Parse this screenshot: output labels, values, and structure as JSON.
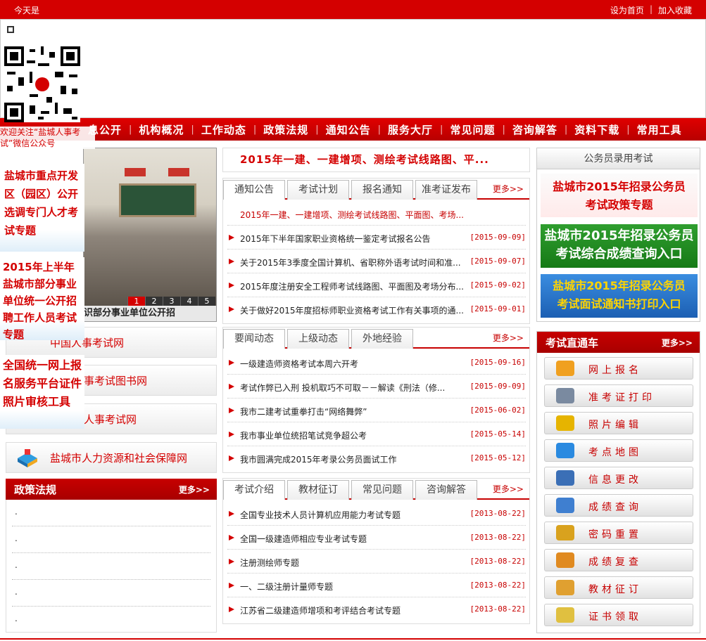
{
  "topbar": {
    "today": "今天是",
    "set_home": "设为首页",
    "sep": "|",
    "add_fav": "加入收藏"
  },
  "nav": {
    "items": [
      "息公开",
      "机构概况",
      "工作动态",
      "政策法规",
      "通知公告",
      "服务大厅",
      "常见问题",
      "咨询解答",
      "资料下载",
      "常用工具"
    ]
  },
  "qr": {
    "caption": "欢迎关注“盐城人事考试”微信公众号"
  },
  "slider": {
    "caption": "识部分事业单位公开招",
    "pages": [
      "1",
      "2",
      "3",
      "4",
      "5"
    ],
    "active": "1"
  },
  "floating_ads": {
    "ad1": "盐城市重点开发区（园区）公开选调专门人才考试专题",
    "ad2": "2015年上半年盐城市部分事业单位统一公开招聘工作人员考试专题",
    "ad3": "全国统一网上报名服务平台证件照片审核工具"
  },
  "left_links": [
    "中国人事考试网",
    "事考试图书网",
    "人事考试网",
    "盐城市人力资源和社会保障网"
  ],
  "policy": {
    "title": "政策法规",
    "more": "更多>>",
    "items": [
      ".",
      ".",
      ".",
      ".",
      "."
    ]
  },
  "headline": "2015年一建、一建增项、测绘考试线路图、平...",
  "panel1": {
    "tabs": [
      "通知公告",
      "考试计划",
      "报名通知",
      "准考证发布"
    ],
    "more": "更多>>",
    "featured": "2015年一建、一建增项、测绘考试线路图、平面图、考场...",
    "rows": [
      {
        "text": "2015年下半年国家职业资格统一鉴定考试报名公告",
        "date": "[2015-09-09]"
      },
      {
        "text": "关于2015年3季度全国计算机、省职称外语考试时间和准...",
        "date": "[2015-09-07]"
      },
      {
        "text": "2015年度注册安全工程师考试线路图、平面图及考场分布...",
        "date": "[2015-09-02]"
      },
      {
        "text": "关于做好2015年度招标师职业资格考试工作有关事项的通...",
        "date": "[2015-09-01]"
      }
    ]
  },
  "panel2": {
    "tabs": [
      "要闻动态",
      "上级动态",
      "外地经验"
    ],
    "more": "更多>>",
    "rows": [
      {
        "text": "一级建造师资格考试本周六开考",
        "date": "[2015-09-16]"
      },
      {
        "text": "考试作弊已入刑 投机取巧不可取－－解读《刑法（修...",
        "date": "[2015-09-09]"
      },
      {
        "text": "我市二建考试重拳打击“网络舞弊”",
        "date": "[2015-06-02]"
      },
      {
        "text": "我市事业单位统招笔试竞争超公考",
        "date": "[2015-05-14]"
      },
      {
        "text": "我市圆满完成2015年考录公务员面试工作",
        "date": "[2015-05-12]"
      }
    ]
  },
  "panel3": {
    "tabs": [
      "考试介绍",
      "教材征订",
      "常见问题",
      "咨询解答"
    ],
    "more": "更多>>",
    "rows": [
      {
        "text": "全国专业技术人员计算机应用能力考试专题",
        "date": "[2013-08-22]"
      },
      {
        "text": "全国一级建造师相应专业考试专题",
        "date": "[2013-08-22]"
      },
      {
        "text": "注册测绘师专题",
        "date": "[2013-08-22]"
      },
      {
        "text": "一、二级注册计量师专题",
        "date": "[2013-08-22]"
      },
      {
        "text": "江苏省二级建造师增项和考评结合考试专题",
        "date": "[2013-08-22]"
      }
    ]
  },
  "gwy": {
    "title": "公务员录用考试",
    "b1a": "盐城市2015年招录公务员",
    "b1b": "考试政策专题",
    "b2a": "盐城市2015年招录公务员",
    "b2b": "考试综合成绩查询入口",
    "b3a": "盐城市2015年招录公务员",
    "b3b": "考试面试通知书打印入口"
  },
  "ztc": {
    "title": "考试直通车",
    "more": "更多>>",
    "buttons": [
      {
        "label": "网上报名",
        "icon": "user-register-icon",
        "color": "#f0a020"
      },
      {
        "label": "准考证打印",
        "icon": "printer-icon",
        "color": "#7a8aa0"
      },
      {
        "label": "照片编辑",
        "icon": "monitor-icon",
        "color": "#e6b400"
      },
      {
        "label": "考点地图",
        "icon": "globe-icon",
        "color": "#2a8ae0"
      },
      {
        "label": "信息更改",
        "icon": "edit-info-icon",
        "color": "#3b6fb6"
      },
      {
        "label": "成绩查询",
        "icon": "magnifier-icon",
        "color": "#3f7fd0"
      },
      {
        "label": "密码重置",
        "icon": "gear-icon",
        "color": "#d9a21e"
      },
      {
        "label": "成绩复查",
        "icon": "magnifier-review-icon",
        "color": "#e08a20"
      },
      {
        "label": "教材征订",
        "icon": "book-icon",
        "color": "#e0a030"
      },
      {
        "label": "证书领取",
        "icon": "certificate-icon",
        "color": "#e0c040"
      }
    ]
  }
}
